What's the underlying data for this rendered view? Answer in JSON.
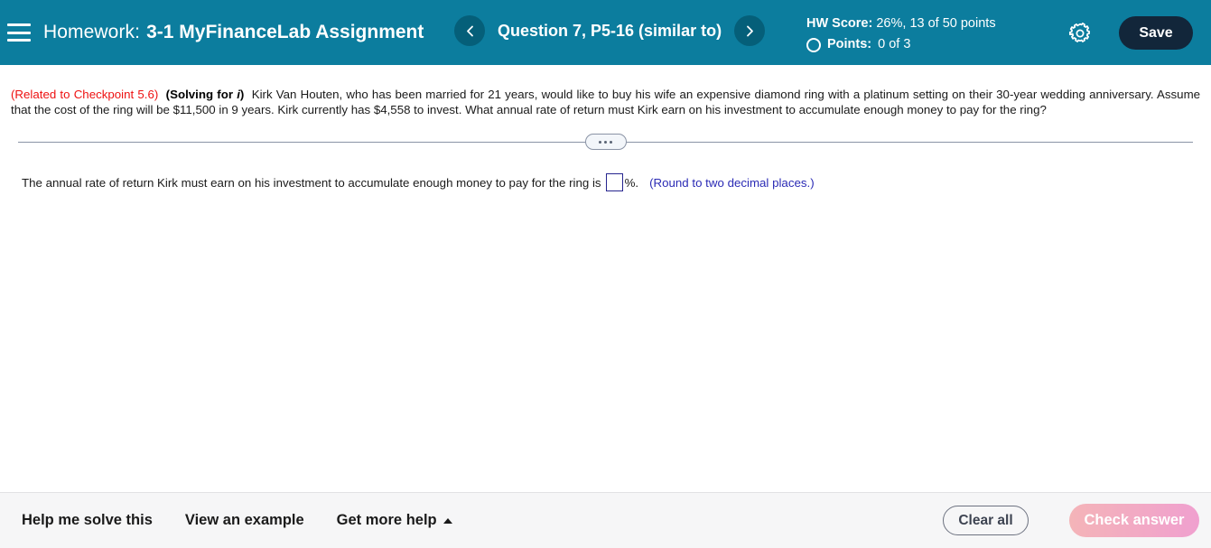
{
  "header": {
    "menu_icon": "hamburger-icon",
    "homework_label": "Homework:",
    "assignment_title": "3-1 MyFinanceLab Assignment",
    "prev_icon": "chevron-left-icon",
    "next_icon": "chevron-right-icon",
    "question_title": "Question 7, P5-16 (similar to)",
    "hw_score_label": "HW Score:",
    "hw_score_value": "26%, 13 of 50 points",
    "points_label": "Points:",
    "points_value": "0 of 3",
    "status_icon": "empty-circle-icon",
    "settings_icon": "gear-icon",
    "save_label": "Save",
    "accent_teal": "#0c7d9e",
    "nav_button_teal": "#055f79",
    "save_button_color": "#12263a"
  },
  "question": {
    "checkpoint_tag": "(Related to Checkpoint 5.6)",
    "checkpoint_color": "#ee1111",
    "solving_prefix": "(Solving for ",
    "solving_var": "i",
    "solving_suffix": ")",
    "body": "Kirk Van Houten, who has been married for 21 years, would like to buy his wife an expensive diamond ring with a platinum setting on their 30-year wedding anniversary.  Assume that the cost of the ring will be $11,500 in 9 years.  Kirk currently has $4,558 to invest.  What annual rate of return must Kirk earn on his investment to accumulate enough money to pay for the ring?"
  },
  "divider": {
    "handle_icon": "three-dots-collapse-handle"
  },
  "answer": {
    "prompt": "The annual rate of return Kirk must earn on his investment to accumulate enough money to pay for the ring is",
    "input_value": "",
    "input_placeholder": "",
    "unit": "%.",
    "round_note": "(Round to two decimal places.)",
    "note_color": "#2b2bb5"
  },
  "footer": {
    "help_links": [
      {
        "label": "Help me solve this",
        "has_caret": false
      },
      {
        "label": "View an example",
        "has_caret": false
      },
      {
        "label": "Get more help",
        "has_caret": true
      }
    ],
    "caret_icon": "caret-up-icon",
    "clear_label": "Clear all",
    "check_label": "Check answer"
  }
}
